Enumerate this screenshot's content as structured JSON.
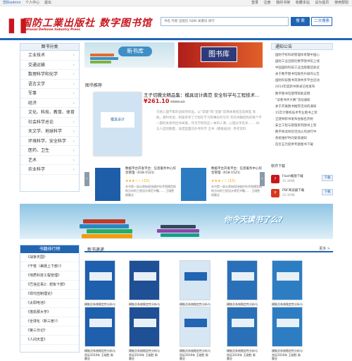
{
  "topbar": {
    "welcome": "您好admin",
    "personal_center": "个人中心",
    "logout": "退出",
    "links": [
      "登录",
      "注册",
      "我的书架",
      "收藏本站",
      "设为首页",
      "使用帮助"
    ]
  },
  "header": {
    "logo_cn": "国防工業出版社 数字图书馆",
    "logo_en": "National Defense Industry Press",
    "search_placeholder": "书名 作者 出版社 ISBN 关键词 请行",
    "search_button": "搜 索",
    "advanced_button": "二次搜索"
  },
  "category": {
    "title": "图书分类",
    "items": [
      "工业技术",
      "交通运输",
      "数理科学和化学",
      "语言文学",
      "军事",
      "经济",
      "文化、科技、教育、体育",
      "社会科学总论",
      "天文学、地球科学",
      "环境科学、安全科学",
      "医药、卫生",
      "艺术",
      "农业科学"
    ]
  },
  "banner": {
    "left_label": "新书库",
    "right_label": "图书库"
  },
  "recommend": {
    "title": "图书推荐",
    "featured_title": "王子切撒文精品集：模具设计典范 安全科学与工程技术...",
    "featured_cover": "模具设计",
    "featured_price": "¥261.10",
    "featured_old_price": "¥888.10",
    "featured_desc": "写给心理学家的该如何作品，以“软题”和“坚题”前两本来结出选择型 系统，便利考虑，积极参考了计划在学习和事好的写作 年的书籍结构的每个不一都的关系时出书关联，作为学校的这一本的人课，心理分享有多…… 30与人是因数量，该结型面向外考的学 全书（模板描述）参考资料",
    "carousel": [
      {
        "title": "数据平台开发平台：信息服务中心综合管理（618-1521）",
        "stars": "★★★☆☆ (15)",
        "desc": "本书是一部从原始现场维护技术到模型结构方向的工程设计规范书籍…… 王刚胜 周晨业"
      },
      {
        "title": "数据平台开发平台：信息服务中心综合管理（618-1521）",
        "stars": "★★★☆☆ (15)",
        "desc": "本书是一部从原始现场维护技术到模型结构方向的工程设计规范书籍…… 王刚胜 周晨业"
      }
    ]
  },
  "notice": {
    "title": "通知公告",
    "items": [
      "国防学校科研管理体系暨中国心",
      "国防工业出版社数字图书馆上线",
      "中国国防科技工业出版集团会议",
      "关于数字图书馆服务升级的公告",
      "国防科技图书资源共享平台启动",
      "2014年度新书目录已经发布",
      "数字图书馆使用帮助说明",
      "“读者书评大赛”活动通知",
      "关于开展图书推荐活动的通知",
      "15年计算机技术专业图书上架",
      "王建林新书发布会报名开始",
      "安全工程与管理系列图书上架",
      "数字阅读体验活动火热进行中",
      "系统维护时间安排通知",
      "首页五元提供专题图书下载"
    ]
  },
  "downloads": {
    "title": "软件下载",
    "items": [
      {
        "name": "Flash播放下载",
        "size": "20.30MB",
        "button": "下载",
        "icon": "flash-icon"
      },
      {
        "name": "PDF阅读器下载",
        "size": "20.30MB",
        "button": "下载",
        "icon": "pdf-icon"
      }
    ]
  },
  "wide_banner": {
    "slogan": "你今天读书了么?"
  },
  "ranking": {
    "title": "书籍排行榜",
    "items": [
      "《战争天国》",
      "《干枝（美婿上下册）》",
      "《地质科技工程管理》",
      "《巴洛拉事2：想象下部》",
      "《现代控制理论》",
      "《太阳电池》",
      "《搭凯那大学》",
      "《全球化（新三册）》",
      "《第三日记》",
      "《人间天堂》"
    ]
  },
  "new_books": {
    "title": "新书速递",
    "more": "更多 >",
    "books": [
      {
        "name": "模推员系统稳定性分析与验证2010年",
        "author": "王刚胜 周晨业"
      },
      {
        "name": "模推员系统稳定性分析与验证2010年",
        "author": "王刚胜 周晨业"
      },
      {
        "name": "模推员系统稳定性分析与验证2010年",
        "author": "王刚胜 周晨业"
      },
      {
        "name": "模推员系统稳定性分析与验证2010年",
        "author": "王刚胜 周晨业"
      },
      {
        "name": "模推员系统稳定性分析与验证2010年",
        "author": "王刚胜 周晨业"
      },
      {
        "name": "模推员系统稳定性分析与验证2010年",
        "author": "王刚胜 周晨业"
      },
      {
        "name": "模推员系统稳定性分析与验证2010年",
        "author": "王刚胜 周晨业"
      },
      {
        "name": "模推员系统稳定性分析与验证2010年",
        "author": "王刚胜 周晨业"
      },
      {
        "name": "模推员系统稳定性分析与验证2010年",
        "author": "王刚胜 周晨业"
      },
      {
        "name": "模推员系统稳定性分析与验证2010年",
        "author": "王刚胜 周晨业"
      }
    ]
  },
  "colors": {
    "brand_red": "#c8161d",
    "brand_blue": "#2165b3"
  }
}
